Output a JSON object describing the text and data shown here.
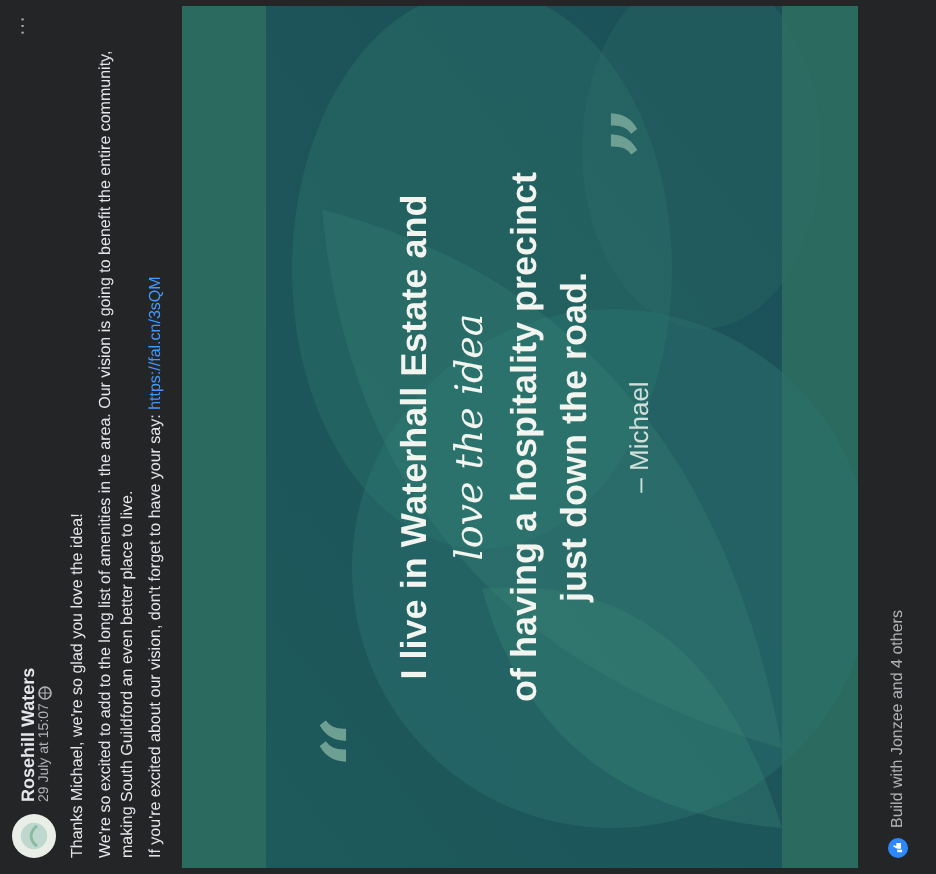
{
  "post": {
    "author": "Rosehill Waters",
    "timestamp": "29 July at 15:07",
    "menu": "···",
    "paragraphs": [
      "Thanks Michael, we're so glad you love the idea!",
      "We're so excited to add to the long list of amenities in the area. Our vision is going to benefit the entire community, making South Guildford an even better place to live."
    ],
    "cta": "If you're excited about our vision, don't forget to have your say:",
    "link": "https://fal.cn/3sQM"
  },
  "image": {
    "open_quote": "“",
    "close_quote": "”",
    "quote_lines": [
      {
        "kind": "plain",
        "text": "I live in Waterhall Estate and"
      },
      {
        "kind": "script",
        "text": "love the idea"
      },
      {
        "kind": "plain",
        "text": "of having a hospitality precinct"
      },
      {
        "kind": "plain",
        "text": "just down the road."
      }
    ],
    "attribution": "– Michael"
  },
  "reactions": {
    "text": "Build with Jonzee and 4 others"
  }
}
